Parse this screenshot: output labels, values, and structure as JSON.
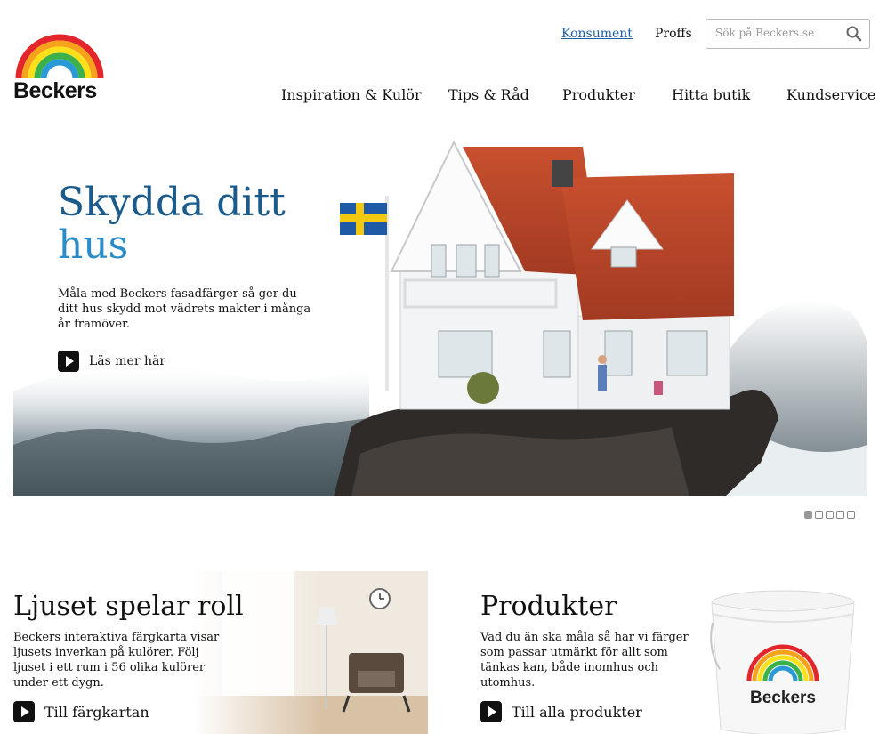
{
  "brand": {
    "name": "Beckers"
  },
  "header": {
    "links": [
      {
        "label": "Konsument",
        "active": true
      },
      {
        "label": "Proffs",
        "active": false
      }
    ],
    "search": {
      "placeholder": "Sök på Beckers.se",
      "icon": "search-icon"
    }
  },
  "nav": {
    "items": [
      {
        "label": "Inspiration & Kulör"
      },
      {
        "label": "Tips & Råd"
      },
      {
        "label": "Produkter"
      },
      {
        "label": "Hitta butik"
      },
      {
        "label": "Kundservice"
      }
    ]
  },
  "hero": {
    "title_line1": "Skydda ditt",
    "title_line2": "hus",
    "text": "Måla med Beckers fasadfärger så ger du ditt hus skydd mot vädrets makter i många år framöver.",
    "cta_label": "Läs mer här",
    "slides": 5,
    "active_slide": 1
  },
  "panels": {
    "left": {
      "title": "Ljuset spelar roll",
      "text": "Beckers interaktiva färgkarta visar ljusets inverkan på kulörer. Följ ljuset i ett rum i 56 olika kulörer under ett dygn.",
      "cta_label": "Till färgkartan"
    },
    "right": {
      "title": "Produkter",
      "text": "Vad du än ska måla så har vi färger som passar utmärkt för allt som tänkas kan, både inomhus och utomhus.",
      "cta_label": "Till alla produkter",
      "bucket_label": "Beckers"
    }
  },
  "colors": {
    "title_dark_blue": "#1a5b8c",
    "title_light_blue": "#2b8cc7",
    "link_blue": "#1f5fa6",
    "rainbow": [
      "#e3262b",
      "#f7a21b",
      "#fde01a",
      "#3bb14a",
      "#2a9ad6"
    ]
  }
}
